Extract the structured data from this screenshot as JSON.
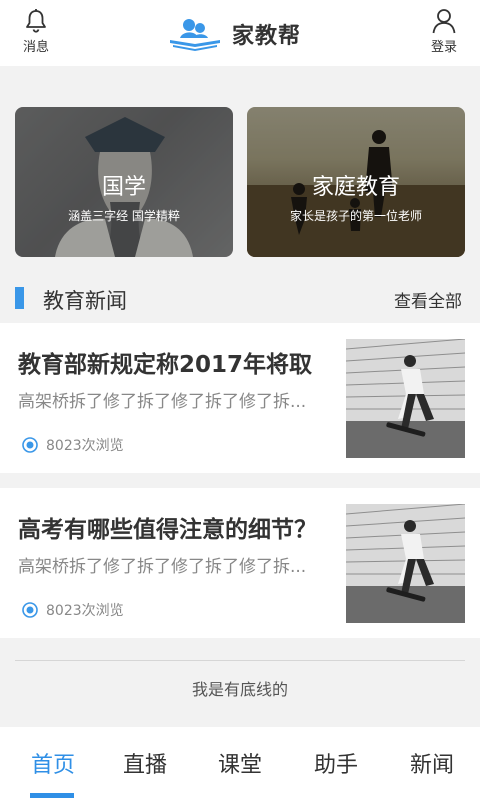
{
  "header": {
    "app_title": "家教帮",
    "left_button_label": "消息",
    "right_button_label": "登录"
  },
  "category_cards": [
    {
      "title": "国学",
      "subtitle": "涵盖三字经 国学精粹"
    },
    {
      "title": "家庭教育",
      "subtitle": "家长是孩子的第一位老师"
    }
  ],
  "section": {
    "title": "教育新闻",
    "more_label": "查看全部"
  },
  "news": [
    {
      "title": "教育部新规定称2017年将取",
      "description": "高架桥拆了修了拆了修了拆了修了拆...",
      "views": "8023次浏览"
    },
    {
      "title": "高考有哪些值得注意的细节？",
      "description": "高架桥拆了修了拆了修了拆了修了拆...",
      "views": "8023次浏览"
    }
  ],
  "footer_note": "我是有底线的",
  "tabs": [
    {
      "label": "首页"
    },
    {
      "label": "直播"
    },
    {
      "label": "课堂"
    },
    {
      "label": "助手"
    },
    {
      "label": "新闻"
    }
  ],
  "active_tab_index": 0,
  "colors": {
    "accent": "#2f8fe6",
    "section_bar": "#3a97e8"
  }
}
